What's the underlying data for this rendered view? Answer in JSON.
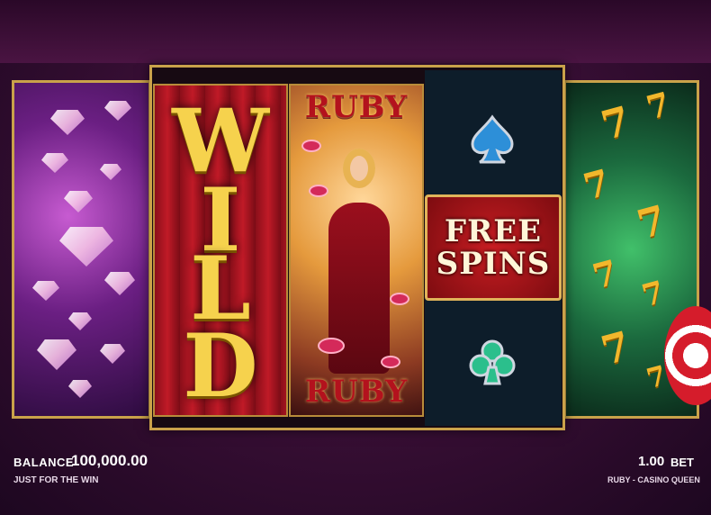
{
  "reels": {
    "wild_symbol": "WILD",
    "ruby_top": "RUBY",
    "ruby_bottom": "RUBY",
    "free_spins": [
      "FREE",
      "SPINS"
    ],
    "symbols": [
      "diamonds",
      "wild",
      "ruby-queen",
      "spade",
      "free-spins",
      "club",
      "sevens"
    ]
  },
  "hud": {
    "balance_label": "BALANCE",
    "balance_value": "100,000.00",
    "mode_text": "JUST FOR THE WIN",
    "bet_value": "1.00",
    "bet_label": "BET",
    "game_name": "RUBY - CASINO QUEEN"
  },
  "colors": {
    "gold_frame": "#c9a24a",
    "wild_gold": "#f6d24d",
    "ruby_red": "#b3121d"
  },
  "icons": [
    "gem-icon",
    "spade-icon",
    "club-icon",
    "seven-icon",
    "spin-button-icon"
  ]
}
